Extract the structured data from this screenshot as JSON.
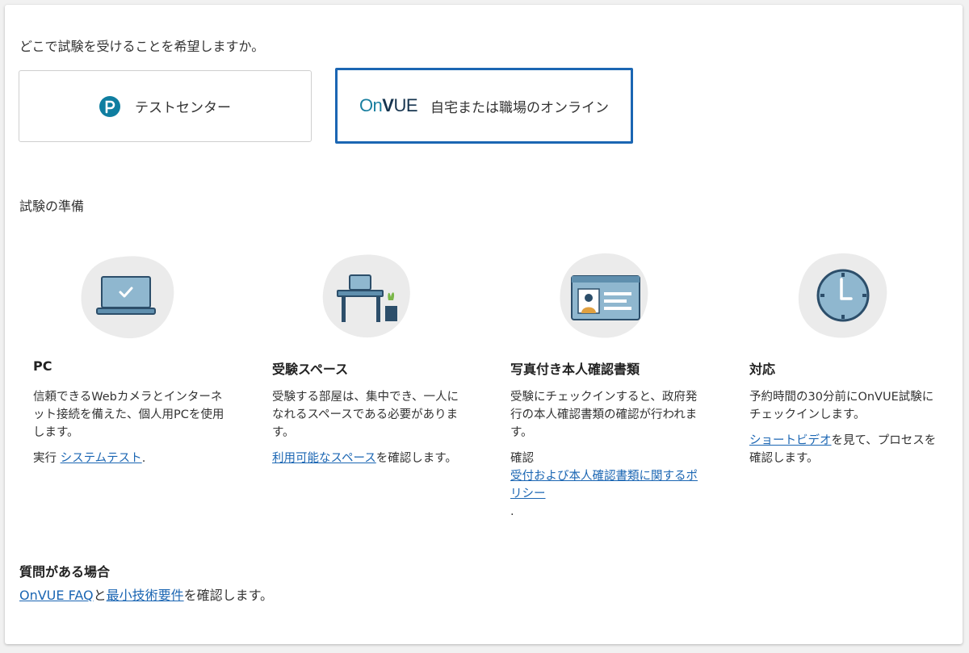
{
  "location": {
    "question": "どこで試験を受けることを希望しますか。",
    "options": [
      {
        "label": "テストセンター",
        "selected": false
      },
      {
        "label": "自宅または職場のオンライン",
        "selected": true
      }
    ],
    "onvue_logo": {
      "part1": "On",
      "part2": "V",
      "part3": "UE"
    }
  },
  "prep": {
    "title": "試験の準備",
    "items": [
      {
        "icon": "laptop-check-icon",
        "heading": "PC",
        "text": "信頼できるWebカメラとインターネット接続を備えた、個人用PCを使用します。",
        "pre": "実行 ",
        "link": "システムテスト",
        "post": "."
      },
      {
        "icon": "desk-icon",
        "heading": "受験スペース",
        "text": "受験する部屋は、集中でき、一人になれるスペースである必要があります。",
        "pre": "",
        "link": "利用可能なスペース",
        "post": "を確認します。"
      },
      {
        "icon": "id-card-icon",
        "heading": "写真付き本人確認書類",
        "text": "受験にチェックインすると、政府発行の本人確認書類の確認が行われます。",
        "pre": "確認",
        "link": "受付および本人確認書類に関するポリシー",
        "post": "."
      },
      {
        "icon": "clock-icon",
        "heading": "対応",
        "text": "予約時間の30分前にOnVUE試験にチェックインします。",
        "pre": "",
        "link": "ショートビデオ",
        "post": "を見て、プロセスを確認します。"
      }
    ]
  },
  "faq": {
    "title": "質問がある場合",
    "link1": "OnVUE FAQ",
    "mid": "と",
    "link2": "最小技術要件",
    "post": "を確認します。"
  },
  "colors": {
    "selected_border": "#1b66b3",
    "link": "#1b66b3",
    "icon_blob": "#ebebeb",
    "icon_fill": "#8fb7cf",
    "icon_dark": "#2c4e6a"
  }
}
